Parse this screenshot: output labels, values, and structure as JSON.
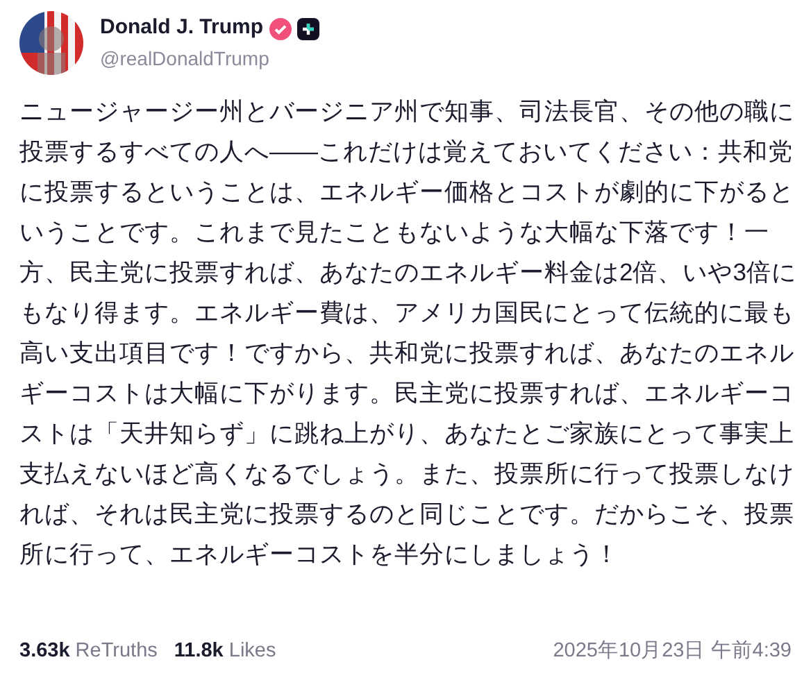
{
  "author": {
    "name": "Donald J. Trump",
    "handle": "@realDonaldTrump",
    "verified": true
  },
  "post": {
    "text": "ニュージャージー州とバージニア州で知事、司法長官、その他の職に投票するすべての人へ——これだけは覚えておいてください：共和党に投票するということは、エネルギー価格とコストが劇的に下がるということです。これまで見たこともないような大幅な下落です！一方、民主党に投票すれば、あなたのエネルギー料金は2倍、いや3倍にもなり得ます。エネルギー費は、アメリカ国民にとって伝統的に最も高い支出項目です！ですから、共和党に投票すれば、あなたのエネルギーコストは大幅に下がります。民主党に投票すれば、エネルギーコストは「天井知らず」に跳ね上がり、あなたとご家族にとって事実上支払えないほど高くなるでしょう。また、投票所に行って投票しなければ、それは民主党に投票するのと同じことです。だからこそ、投票所に行って、エネルギーコストを半分にしましょう！"
  },
  "stats": [
    {
      "count": "3.63k",
      "label": "ReTruths"
    },
    {
      "count": "11.8k",
      "label": "Likes"
    }
  ],
  "timestamp": "2025年10月23日 午前4:39"
}
